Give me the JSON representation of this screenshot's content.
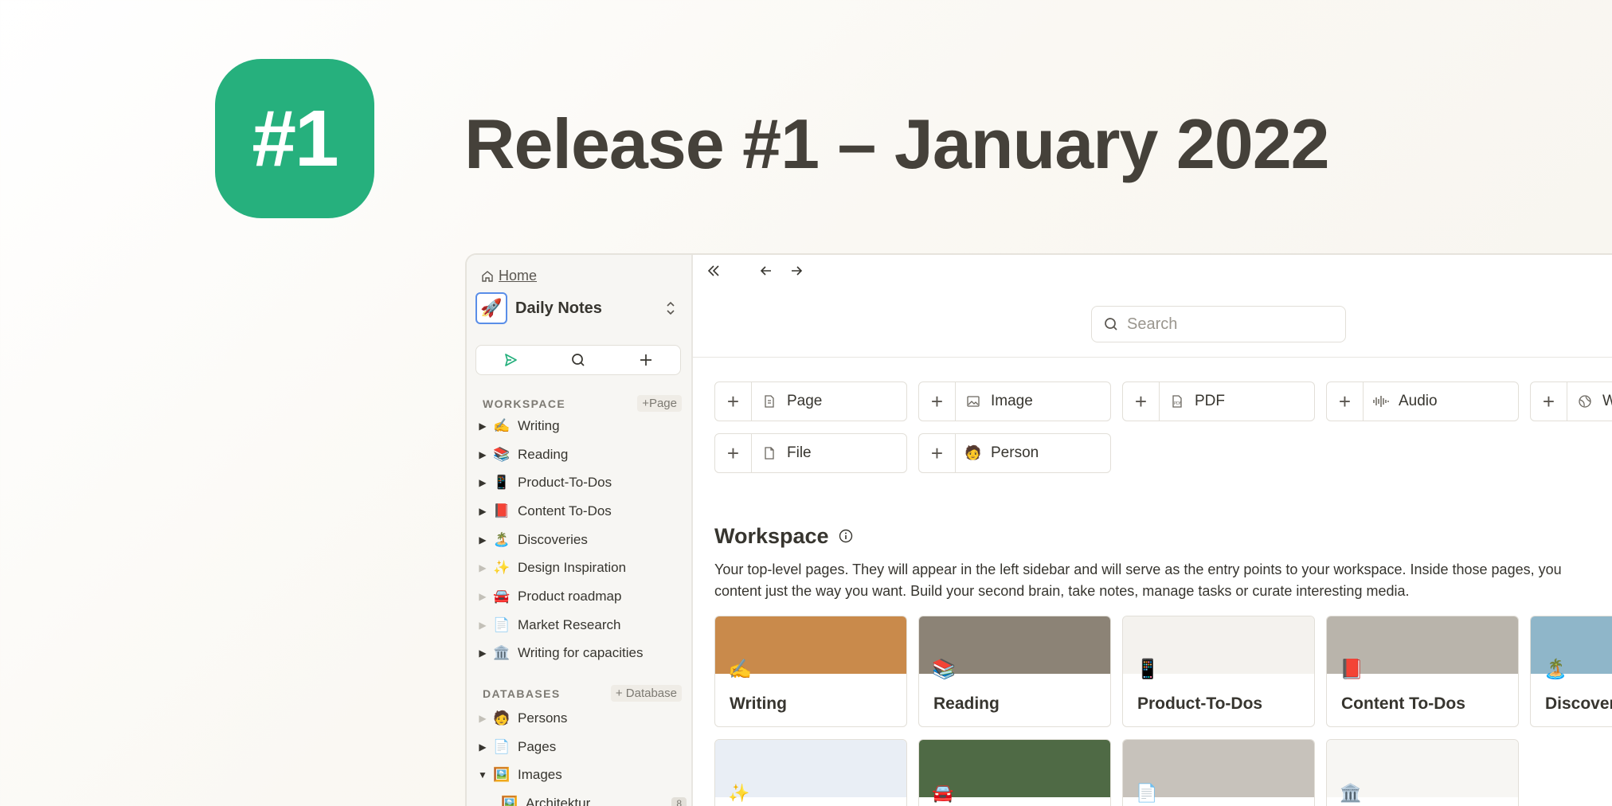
{
  "hero": {
    "badge": "#1",
    "title": "Release #1 – January 2022"
  },
  "sidebar": {
    "home": "Home",
    "space_name": "Daily Notes",
    "space_icon": "🚀",
    "workspace_label": "WORKSPACE",
    "workspace_add": "Page",
    "workspace_items": [
      {
        "emoji": "✍️",
        "label": "Writing",
        "expandable": true
      },
      {
        "emoji": "📚",
        "label": "Reading",
        "expandable": true
      },
      {
        "emoji": "📱",
        "label": "Product-To-Dos",
        "expandable": true
      },
      {
        "emoji": "📕",
        "label": "Content To-Dos",
        "expandable": true
      },
      {
        "emoji": "🏝️",
        "label": "Discoveries",
        "expandable": true
      },
      {
        "emoji": "✨",
        "label": "Design Inspiration",
        "expandable": false
      },
      {
        "emoji": "🚘",
        "label": "Product roadmap",
        "expandable": false
      },
      {
        "emoji": "📄",
        "label": "Market Research",
        "expandable": false
      },
      {
        "emoji": "🏛️",
        "label": "Writing for capacities",
        "expandable": true
      }
    ],
    "databases_label": "DATABASES",
    "databases_add": "Database",
    "database_items": [
      {
        "emoji": "🧑",
        "label": "Persons",
        "expandable": false
      },
      {
        "emoji": "📄",
        "label": "Pages",
        "expandable": true
      },
      {
        "emoji": "🖼️",
        "label": "Images",
        "expandable": true,
        "expanded": true
      }
    ],
    "sub_items": [
      {
        "label": "Architektur",
        "count": "8"
      }
    ]
  },
  "main": {
    "search_placeholder": "Search",
    "types": [
      {
        "label": "Page",
        "icon": "page-icon"
      },
      {
        "label": "Image",
        "icon": "image-icon"
      },
      {
        "label": "PDF",
        "icon": "pdf-icon"
      },
      {
        "label": "Audio",
        "icon": "audio-icon"
      },
      {
        "label": "W",
        "icon": "web-icon"
      },
      {
        "label": "File",
        "icon": "file-icon"
      },
      {
        "label": "Person",
        "icon": "person-icon"
      }
    ],
    "workspace_title": "Workspace",
    "workspace_desc_1": "Your top-level pages. They will appear in the left sidebar and will serve as the entry points to your workspace. Inside those pages, you",
    "workspace_desc_2": "content just the way you want. Build your second brain, take notes, manage tasks or curate interesting media.",
    "cards": [
      {
        "title": "Writing",
        "emoji": "✍️",
        "cover": "#c98a4b"
      },
      {
        "title": "Reading",
        "emoji": "📚",
        "cover": "#8c8376"
      },
      {
        "title": "Product-To-Dos",
        "emoji": "📱",
        "cover": "#f4f2ee"
      },
      {
        "title": "Content To-Dos",
        "emoji": "📕",
        "cover": "#b9b4ab"
      },
      {
        "title": "Discover",
        "emoji": "🏝️",
        "cover": "#8fb6c9"
      }
    ],
    "cards_row2": [
      {
        "emoji": "✨",
        "cover": "#e9eef5"
      },
      {
        "emoji": "🚘",
        "cover": "#4f6a45"
      },
      {
        "emoji": "📄",
        "cover": "#c7c2bb"
      },
      {
        "emoji": "🏛️",
        "cover": "#f7f6f3"
      }
    ]
  }
}
